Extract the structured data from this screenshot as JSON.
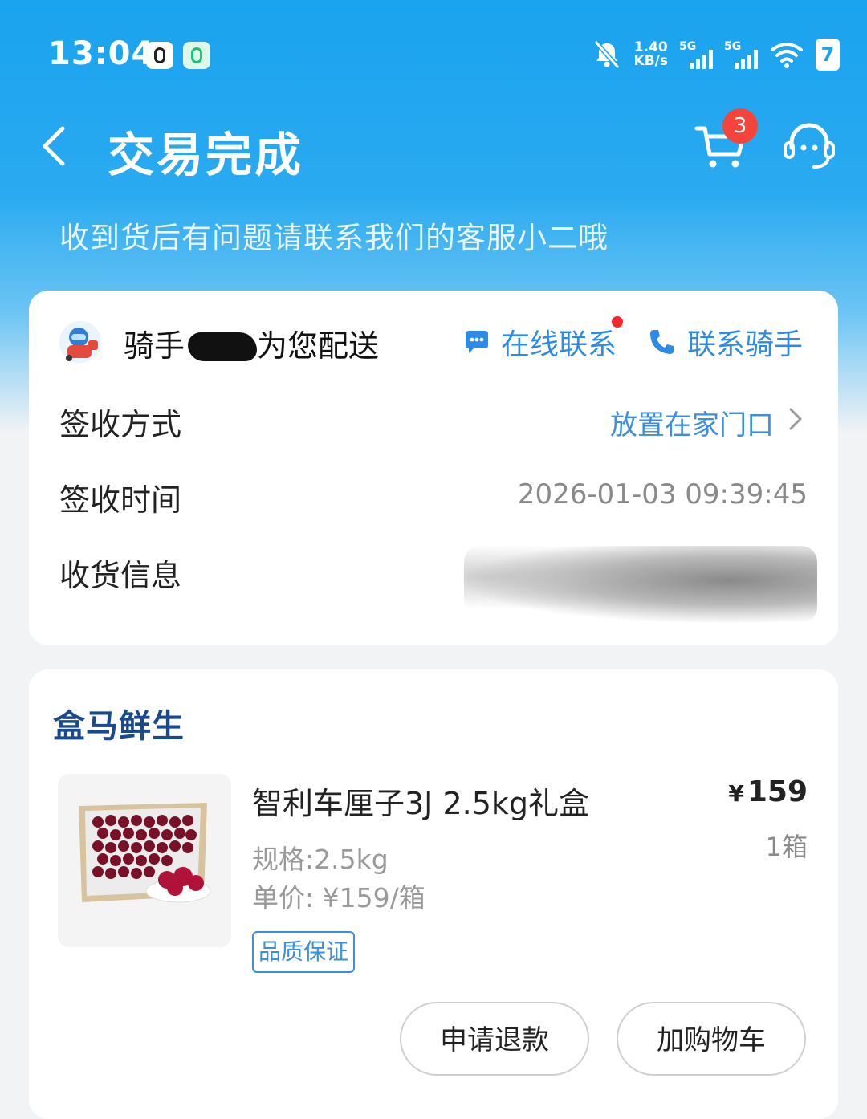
{
  "status_bar": {
    "time": "13:04",
    "net_speed_value": "1.40",
    "net_speed_unit": "KB/s",
    "sim1_label": "5G",
    "sim2_label": "5G",
    "battery": "7"
  },
  "header": {
    "title": "交易完成",
    "cart_badge": "3",
    "subtitle": "收到货后有问题请联系我们的客服小二哦"
  },
  "delivery": {
    "rider_prefix": "骑手",
    "rider_suffix": "为您配送",
    "chat_label": "在线联系",
    "call_label": "联系骑手",
    "rows": [
      {
        "key": "签收方式",
        "value": "放置在家门口"
      },
      {
        "key": "签收时间",
        "value": "2026-01-03 09:39:45"
      },
      {
        "key": "收货信息",
        "value": ""
      }
    ]
  },
  "order": {
    "brand": "盒马鲜生",
    "product_name": "智利车厘子3J 2.5kg礼盒",
    "price_symbol": "¥",
    "price": "159",
    "quantity": "1箱",
    "spec": "规格:2.5kg",
    "unit_price": "单价: ¥159/箱",
    "tag": "品质保证",
    "refund_button": "申请退款",
    "add_cart_button": "加购物车"
  },
  "colors": {
    "header_blue": "#1aa3ef",
    "link_blue": "#3b8fde",
    "badge_red": "#f5443a",
    "brand_navy": "#1a4a8e"
  },
  "icons": [
    "back-arrow-icon",
    "cart-icon",
    "customer-service-icon",
    "chat-bubble-icon",
    "phone-icon",
    "chevron-right-icon",
    "mute-bell-icon",
    "wifi-icon"
  ]
}
